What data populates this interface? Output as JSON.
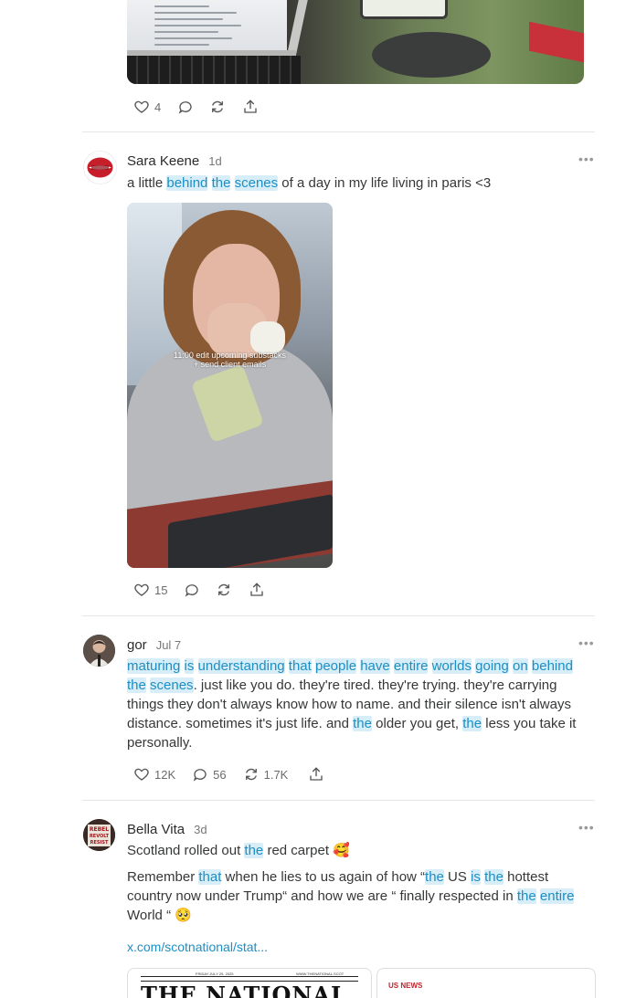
{
  "posts": [
    {
      "id": "top",
      "actions": {
        "likes": "4",
        "comments": "",
        "restacks": ""
      }
    },
    {
      "id": "sara",
      "author": "Sara Keene",
      "time": "1d",
      "text_parts": [
        "a little ",
        "behind",
        " ",
        "the",
        " ",
        "scenes",
        " of a day in my life living in paris <3"
      ],
      "video_caption_line1": "11:00 edit upcoming substacks",
      "video_caption_line2": "+ send client emails",
      "actions": {
        "likes": "15",
        "comments": "",
        "restacks": ""
      }
    },
    {
      "id": "gor",
      "author": "gor",
      "time": "Jul 7",
      "actions": {
        "likes": "12K",
        "comments": "56",
        "restacks": "1.7K"
      }
    },
    {
      "id": "bella",
      "author": "Bella Vita",
      "time": "3d",
      "link": "x.com/scotnational/stat...",
      "card_title": "THE NATIONAL",
      "card_label": "US NEWS",
      "card_dateline_left": "FRIDAY JULY 25, 2025",
      "card_dateline_right": "WWW.THENATIONAL.SCOT"
    }
  ],
  "gor_lines": [
    [
      [
        "maturing",
        1
      ],
      " ",
      [
        "is",
        1
      ],
      " ",
      [
        "understanding",
        1
      ],
      " ",
      [
        "that",
        1
      ],
      " ",
      [
        "people",
        1
      ],
      " ",
      [
        "have",
        1
      ],
      " ",
      [
        "entire",
        1
      ],
      " ",
      [
        "worlds",
        1
      ],
      " ",
      [
        "going",
        1
      ],
      " ",
      [
        "on",
        1
      ],
      " ",
      [
        "behind",
        1
      ]
    ],
    [
      [
        "the",
        1
      ],
      " ",
      [
        "scenes",
        1
      ],
      ". just like you do. they're tired. they're trying. they're carrying"
    ],
    [
      "things they don't always know how to name. and their silence isn't always"
    ],
    [
      "distance. sometimes it's just life. and ",
      [
        "the",
        1
      ],
      " older you get, ",
      [
        "the",
        1
      ],
      " less you take it"
    ],
    [
      "personally."
    ]
  ],
  "bella_lines": [
    [
      "Scotland rolled out ",
      [
        "the",
        1
      ],
      " red carpet 🥰"
    ],
    [
      "Remember ",
      [
        "that",
        1
      ],
      " when he lies to us again of how “",
      [
        "the",
        1
      ],
      " US ",
      [
        "is",
        1
      ],
      " ",
      [
        "the",
        1
      ],
      " hottest"
    ],
    [
      "country now under Trump“ and how we are “ finally respected in ",
      [
        "the",
        1
      ],
      " ",
      [
        "entire",
        1
      ]
    ],
    [
      "World “ 🥺"
    ]
  ],
  "colors": {
    "highlight_bg": "#d7eef8",
    "highlight_text": "#1d8ec4",
    "divider": "#e6e6e6"
  },
  "icons": [
    "heart-icon",
    "comment-icon",
    "restack-icon",
    "share-icon",
    "more-icon"
  ]
}
